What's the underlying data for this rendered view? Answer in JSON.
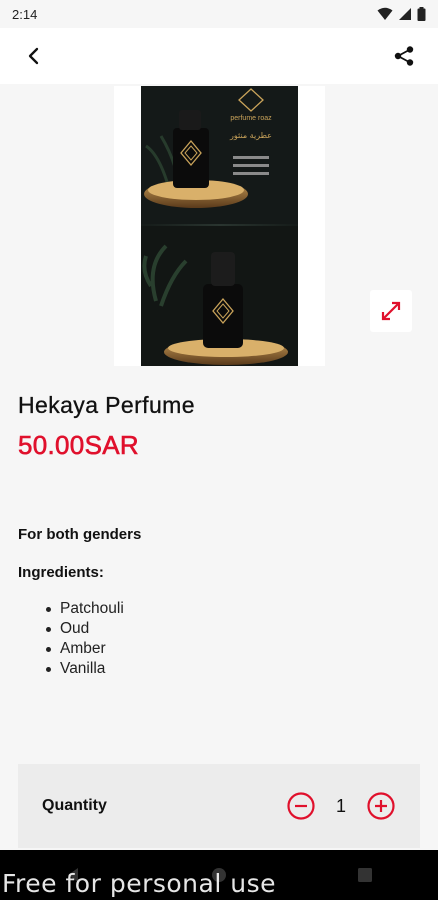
{
  "status_bar": {
    "time": "2:14",
    "icons": [
      "wifi-icon",
      "signal-icon",
      "battery-icon"
    ]
  },
  "app_bar": {
    "back_icon": "back-arrow-icon",
    "share_icon": "share-icon"
  },
  "product": {
    "image_brand": "perfume roaz",
    "image_arabic_text": "عطرية منثور",
    "title": "Hekaya Perfume",
    "price": "50.00SAR",
    "description": "For both genders",
    "ingredients_label": "Ingredients:",
    "ingredients": [
      "Patchouli",
      "Oud",
      "Amber",
      "Vanilla"
    ]
  },
  "quantity": {
    "label": "Quantity",
    "value": "1"
  },
  "watermark": "Free for personal use",
  "colors": {
    "accent": "#e0102c",
    "background": "#f6f6f6",
    "quantity_bg": "#ececec"
  }
}
